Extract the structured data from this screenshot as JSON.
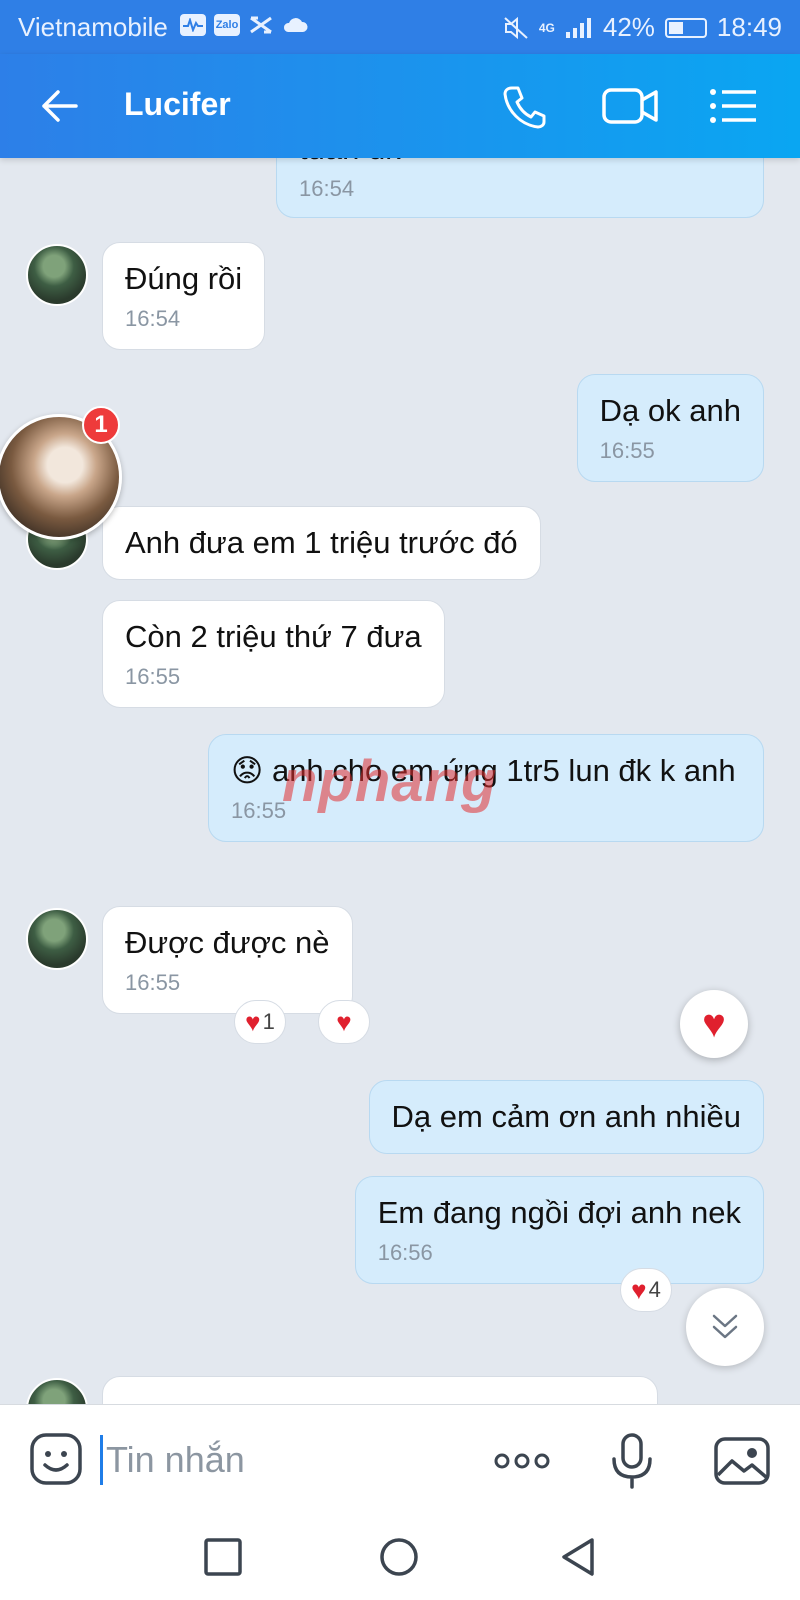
{
  "status_bar": {
    "carrier": "Vietnamobile",
    "app_icons": [
      "activity-icon",
      "zalo-icon",
      "capcut-icon",
      "cloud-icon"
    ],
    "zalo_label": "Zalo",
    "network": "4G",
    "battery_percent": "42%",
    "battery_level": 0.42,
    "time": "18:49"
  },
  "header": {
    "contact_name": "Lucifer",
    "actions": [
      "back-icon",
      "phone-icon",
      "video-call-icon",
      "menu-icon"
    ]
  },
  "unread_badge": "1",
  "messages": [
    {
      "direction": "out",
      "text": "tuần đk",
      "time": "16:54"
    },
    {
      "direction": "in",
      "text": "Đúng rồi",
      "time": "16:54"
    },
    {
      "direction": "out",
      "text": "Dạ ok anh",
      "time": "16:55"
    },
    {
      "direction": "in",
      "text": "Anh đưa em 1 triệu trước đó",
      "time": ""
    },
    {
      "direction": "in",
      "text": "Còn 2 triệu thứ 7 đưa",
      "time": "16:55"
    },
    {
      "direction": "out",
      "emoji": "😟",
      "text": "anh cho em ứng 1tr5 lun đk k anh",
      "time": "16:55"
    },
    {
      "direction": "in",
      "text": "Được được nè",
      "time": "16:55",
      "reaction_count": "1"
    },
    {
      "direction": "out",
      "text": "Dạ em cảm ơn anh nhiều",
      "time": ""
    },
    {
      "direction": "out",
      "text": "Em đang ngồi đợi anh nek",
      "time": "16:56",
      "reaction_count": "4"
    }
  ],
  "watermark": "nphang",
  "input": {
    "placeholder": "Tin nhắn",
    "value": "",
    "buttons": [
      "emoji-icon",
      "more-icon",
      "microphone-icon",
      "image-icon"
    ]
  },
  "nav_bar": {
    "buttons": [
      "recent-apps-icon",
      "home-icon",
      "back-triangle-icon"
    ]
  },
  "colors": {
    "header_start": "#2d7fe8",
    "header_end": "#0aa6f2",
    "outgoing_bubble": "#d5ecfc",
    "incoming_bubble": "#ffffff",
    "chat_background": "#e3e8ef",
    "heart": "#e0202e",
    "badge": "#ee3b3b"
  }
}
